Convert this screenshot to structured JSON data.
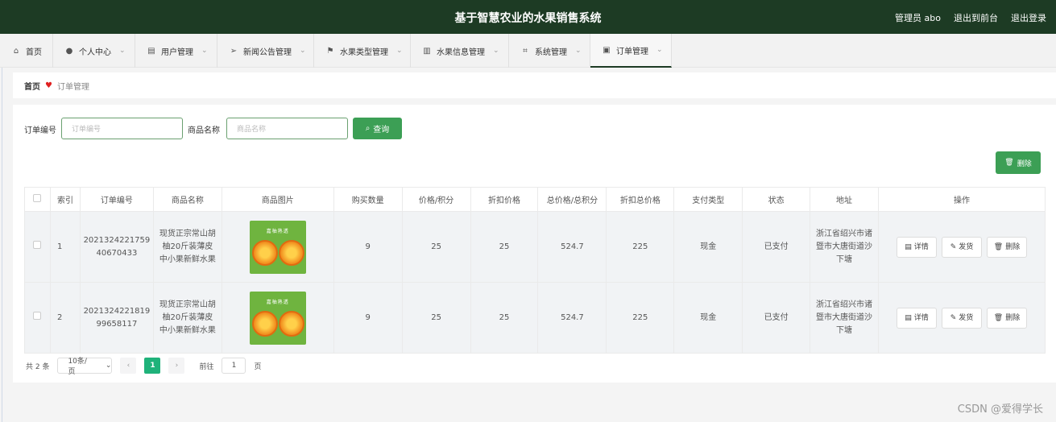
{
  "header": {
    "title": "基于智慧农业的水果销售系统",
    "admin": "管理员 abo",
    "to_front": "退出到前台",
    "logout": "退出登录"
  },
  "nav": [
    {
      "label": "首页",
      "icon": "home-icon",
      "glyph": "⌂",
      "arrow": false
    },
    {
      "label": "个人中心",
      "icon": "user-icon",
      "glyph": "👤",
      "arrow": true
    },
    {
      "label": "用户管理",
      "icon": "clipboard-icon",
      "glyph": "▤",
      "arrow": true
    },
    {
      "label": "新闻公告管理",
      "icon": "send-icon",
      "glyph": "➢",
      "arrow": true
    },
    {
      "label": "水果类型管理",
      "icon": "flag-icon",
      "glyph": "⚑",
      "arrow": true
    },
    {
      "label": "水果信息管理",
      "icon": "bar-chart-icon",
      "glyph": "▥",
      "arrow": true
    },
    {
      "label": "系统管理",
      "icon": "crop-icon",
      "glyph": "⌗",
      "arrow": true
    },
    {
      "label": "订单管理",
      "icon": "order-icon",
      "glyph": "▣",
      "arrow": true
    }
  ],
  "breadcrumb": {
    "home": "首页",
    "current": "订单管理"
  },
  "search": {
    "order_label": "订单编号",
    "order_placeholder": "订单编号",
    "product_label": "商品名称",
    "product_placeholder": "商品名称",
    "query_button": "查询"
  },
  "delete_button": "删除",
  "table": {
    "columns": [
      "索引",
      "订单编号",
      "商品名称",
      "商品图片",
      "购买数量",
      "价格/积分",
      "折扣价格",
      "总价格/总积分",
      "折扣总价格",
      "支付类型",
      "状态",
      "地址",
      "操作"
    ],
    "rows": [
      {
        "index": "1",
        "order_no": "2021324221759 40670433",
        "product": "现货正宗常山胡柚20斤装薄皮中小果新鲜水果",
        "image_text": "嘉柚熟透",
        "qty": "9",
        "price": "25",
        "discount_price": "25",
        "total": "524.7",
        "discount_total": "225",
        "pay_type": "现金",
        "status": "已支付",
        "address": "浙江省绍兴市诸暨市大唐街道沙下塘"
      },
      {
        "index": "2",
        "order_no": "2021324221819 99658117",
        "product": "现货正宗常山胡柚20斤装薄皮中小果新鲜水果",
        "image_text": "嘉柚熟透",
        "qty": "9",
        "price": "25",
        "discount_price": "25",
        "total": "524.7",
        "discount_total": "225",
        "pay_type": "现金",
        "status": "已支付",
        "address": "浙江省绍兴市诸暨市大唐街道沙下塘"
      }
    ],
    "actions": {
      "detail": "详情",
      "ship": "发货",
      "delete": "删除"
    }
  },
  "pagination": {
    "total": "共 2 条",
    "page_size": "10条/页",
    "current_page": "1",
    "goto_label": "前往",
    "goto_value": "1",
    "page_unit": "页"
  },
  "watermark": "CSDN @爱得学长",
  "colors": {
    "header_bg": "#1d3b24",
    "accent": "#3c9f55",
    "page_active": "#1fb27a"
  }
}
